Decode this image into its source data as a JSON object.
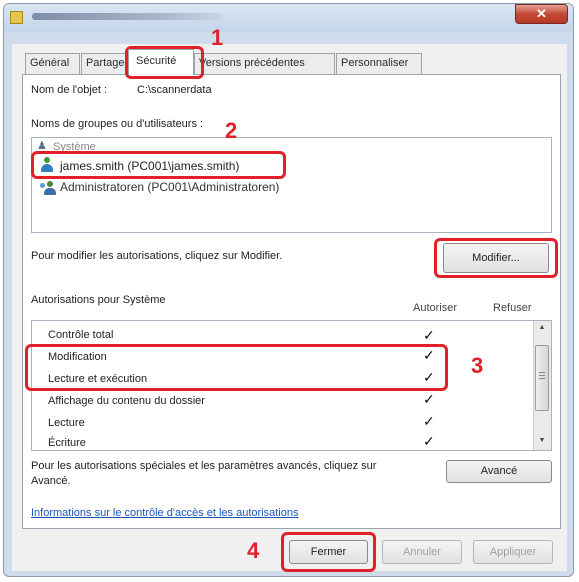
{
  "window": {
    "close_glyph": "✕"
  },
  "tabs": [
    {
      "label": "Général"
    },
    {
      "label": "Partage"
    },
    {
      "label": "Sécurité"
    },
    {
      "label": "Versions précédentes"
    },
    {
      "label": "Personnaliser"
    }
  ],
  "object": {
    "label": "Nom de l'objet :",
    "value": "C:\\scannerdata"
  },
  "groups": {
    "label": "Noms de groupes ou d'utilisateurs :",
    "items": [
      {
        "name": "Système"
      },
      {
        "name": "james.smith (PC001\\james.smith)"
      },
      {
        "name": "Administratoren (PC001\\Administratoren)"
      }
    ]
  },
  "modify": {
    "hint": "Pour modifier les autorisations, cliquez sur Modifier.",
    "button": "Modifier..."
  },
  "permissions": {
    "title": "Autorisations pour Système",
    "col_allow": "Autoriser",
    "col_deny": "Refuser",
    "check": "✓",
    "rows": [
      {
        "label": "Contrôle total"
      },
      {
        "label": "Modification"
      },
      {
        "label": "Lecture et exécution"
      },
      {
        "label": "Affichage du contenu du dossier"
      },
      {
        "label": "Lecture"
      },
      {
        "label": "Écriture"
      }
    ]
  },
  "special": {
    "line1": "Pour les autorisations spéciales et les paramètres avancés, cliquez sur",
    "line2": "Avancé.",
    "button": "Avancé"
  },
  "link": "Informations sur le contrôle d'accès et les autorisations",
  "footer": {
    "close": "Fermer",
    "cancel": "Annuler",
    "apply": "Appliquer"
  },
  "callouts": [
    "1",
    "2",
    "3",
    "4"
  ],
  "colors": {
    "callout": "#e2202a",
    "link": "#1a55b5"
  }
}
